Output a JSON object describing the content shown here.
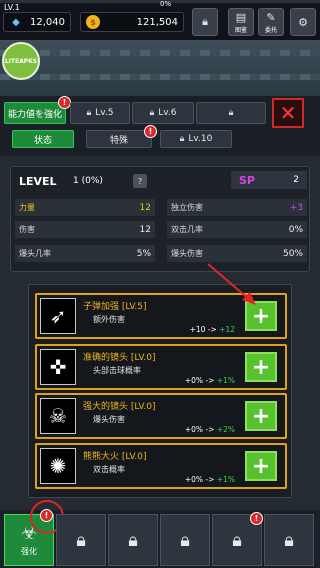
{
  "player": {
    "level": "LV.1",
    "xp_percent": "0%"
  },
  "currency": {
    "gems": "12,040",
    "gold": "121,504"
  },
  "top_buttons": [
    {
      "name": "lock",
      "label": ""
    },
    {
      "name": "encyclopedia",
      "label": "图鉴"
    },
    {
      "name": "commission",
      "label": "委托"
    },
    {
      "name": "settings",
      "label": ""
    }
  ],
  "watermark": "LITEAPKS",
  "tabs_row1": [
    {
      "label": "能力値を強化",
      "active": true
    },
    {
      "label": "Lv.5"
    },
    {
      "label": "Lv.6"
    },
    {
      "label": ""
    }
  ],
  "tabs_row2": [
    {
      "label": "状态",
      "active": true
    },
    {
      "label": "特殊"
    },
    {
      "label": "Lv.10"
    }
  ],
  "badge_mark": "!",
  "stats_panel": {
    "level_label": "LEVEL",
    "level_value": "1 (0%)",
    "help": "?",
    "sp_label": "SP",
    "sp_value": "2",
    "left": [
      {
        "name": "力量",
        "value": "12",
        "highlight": true
      },
      {
        "name": "伤害",
        "value": "12"
      },
      {
        "name": "爆头几率",
        "value": "5%"
      }
    ],
    "right": [
      {
        "name": "独立伤害",
        "value": "+3"
      },
      {
        "name": "双击几率",
        "value": "0%"
      },
      {
        "name": "爆头伤害",
        "value": "50%"
      }
    ]
  },
  "skills": [
    {
      "title": "子弹加强 [LV.5]",
      "desc": "额外伤害",
      "from": "+10 -> ",
      "to": "+12",
      "icon": "bullet-icon"
    },
    {
      "title": "准确的镜头 [LV.0]",
      "desc": "头部击球概率",
      "from": "+0% -> ",
      "to": "+1%",
      "icon": "aim-icon"
    },
    {
      "title": "强大的镜头 [LV.0]",
      "desc": "爆头伤害",
      "from": "+0% -> ",
      "to": "+2%",
      "icon": "skull-icon"
    },
    {
      "title": "熊熊大火 [LV.0]",
      "desc": "双击概率",
      "from": "+0% -> ",
      "to": "+1%",
      "icon": "fire-icon"
    }
  ],
  "plus": "+",
  "bottom_nav": [
    {
      "label": "强化",
      "active": true
    },
    {
      "label": ""
    },
    {
      "label": ""
    },
    {
      "label": ""
    },
    {
      "label": ""
    },
    {
      "label": ""
    }
  ],
  "colors": {
    "accent_green": "#1e8a3a",
    "gold": "#f0c420",
    "alert_red": "#d72b2b",
    "sp_purple": "#d046e8"
  }
}
